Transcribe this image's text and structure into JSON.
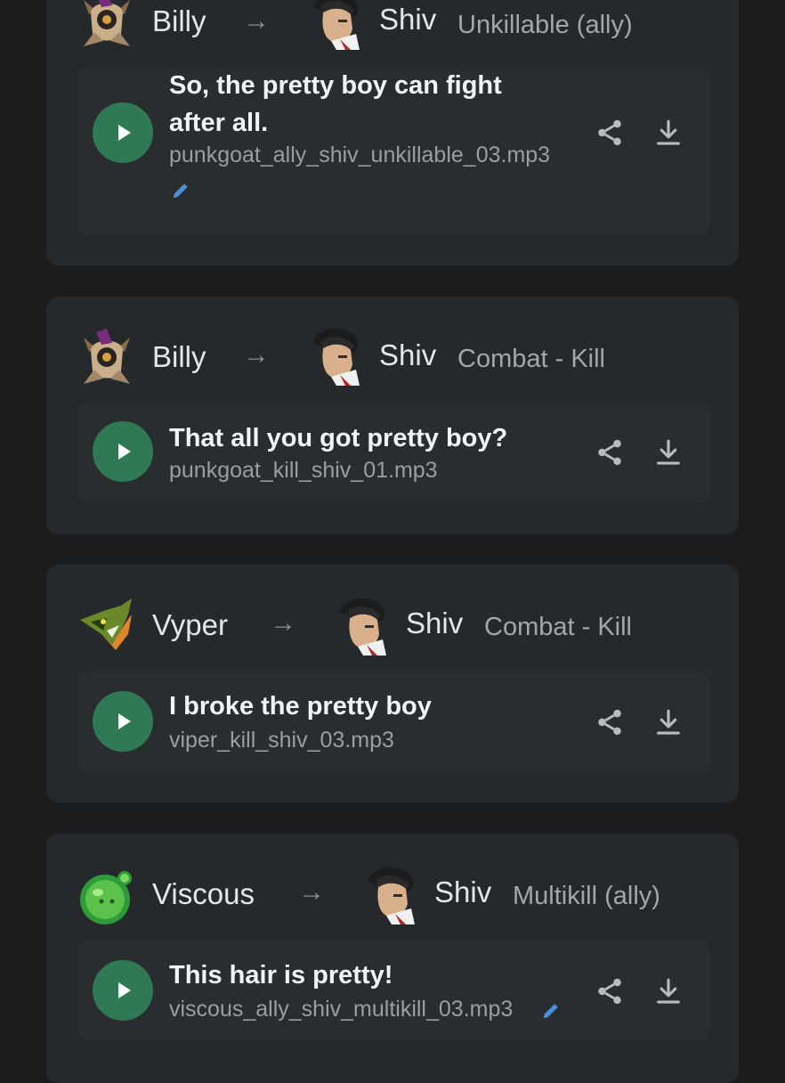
{
  "cards": [
    {
      "speaker": "Billy",
      "target": "Shiv",
      "tag": "Unkillable (ally)",
      "quote_line1": "So, the pretty boy can fight",
      "quote_line2": "after all.",
      "file": "punkgoat_ally_shiv_unkillable_03.mp3"
    },
    {
      "speaker": "Billy",
      "target": "Shiv",
      "tag": "Combat - Kill",
      "quote": "That all you got pretty boy?",
      "file": "punkgoat_kill_shiv_01.mp3"
    },
    {
      "speaker": "Vyper",
      "target": "Shiv",
      "tag": "Combat - Kill",
      "quote": "I broke the pretty boy",
      "file": "viper_kill_shiv_03.mp3"
    },
    {
      "speaker": "Viscous",
      "target": "Shiv",
      "tag": "Multikill (ally)",
      "quote": "This hair is pretty!",
      "file": "viscous_ally_shiv_multikill_03.mp3"
    }
  ],
  "arrow_glyph": "→",
  "icons": {
    "play": "play-icon",
    "share": "share-icon",
    "download": "download-icon",
    "edit": "pencil-icon"
  },
  "colors": {
    "background": "#1b1c1e",
    "card": "#26292c",
    "clip": "#2a2d30",
    "play_button": "#2f7a55",
    "edit_icon": "#4a90d9"
  }
}
